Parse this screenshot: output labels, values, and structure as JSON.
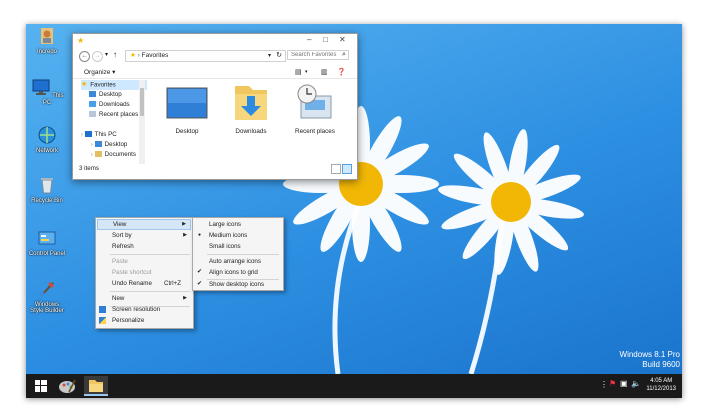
{
  "desktop": {
    "icons": [
      {
        "label": "Incredo",
        "icon": "user-icon"
      },
      {
        "label": "This PC",
        "icon": "computer-icon"
      },
      {
        "label": "Network",
        "icon": "network-icon"
      },
      {
        "label": "Recycle Bin",
        "icon": "recycle-bin-icon"
      },
      {
        "label": "Control Panel",
        "icon": "control-panel-icon"
      },
      {
        "label": "Windows Style Builder",
        "icon": "style-builder-icon"
      }
    ],
    "watermark": {
      "line1": "Windows 8.1 Pro",
      "line2": "Build 9600"
    }
  },
  "explorer": {
    "path_label": "Favorites",
    "search_placeholder": "Search Favorites",
    "controls": {
      "minimize": "–",
      "maximize": "□",
      "close": "✕"
    },
    "organize_label": "Organize ▾",
    "nav_items": [
      {
        "label": "Favorites",
        "selected": true,
        "icon": "star-icon"
      },
      {
        "label": "Desktop",
        "selected": false,
        "icon": "desktop-icon"
      },
      {
        "label": "Downloads",
        "selected": false,
        "icon": "downloads-icon"
      },
      {
        "label": "Recent places",
        "selected": false,
        "icon": "recent-places-icon"
      },
      {
        "label": "",
        "selected": false,
        "icon": ""
      },
      {
        "label": "This PC",
        "selected": false,
        "icon": "computer-icon"
      },
      {
        "label": "Desktop",
        "selected": false,
        "icon": "desktop-icon"
      },
      {
        "label": "Documents",
        "selected": false,
        "icon": "documents-icon"
      }
    ],
    "items": [
      {
        "label": "Desktop",
        "icon": "desktop-folder-icon"
      },
      {
        "label": "Downloads",
        "icon": "downloads-folder-icon"
      },
      {
        "label": "Recent places",
        "icon": "recent-places-folder-icon"
      }
    ],
    "status": "3 items"
  },
  "context_menu": {
    "items": [
      {
        "label": "View",
        "has_submenu": true,
        "highlighted": true,
        "disabled": false,
        "shortcut": ""
      },
      {
        "label": "Sort by",
        "has_submenu": true,
        "highlighted": false,
        "disabled": false,
        "shortcut": ""
      },
      {
        "label": "Refresh",
        "has_submenu": false,
        "highlighted": false,
        "disabled": false,
        "shortcut": ""
      },
      {
        "label": "Paste",
        "has_submenu": false,
        "highlighted": false,
        "disabled": true,
        "shortcut": ""
      },
      {
        "label": "Paste shortcut",
        "has_submenu": false,
        "highlighted": false,
        "disabled": true,
        "shortcut": ""
      },
      {
        "label": "Undo Rename",
        "has_submenu": false,
        "highlighted": false,
        "disabled": false,
        "shortcut": "Ctrl+Z"
      },
      {
        "label": "New",
        "has_submenu": true,
        "highlighted": false,
        "disabled": false,
        "shortcut": ""
      },
      {
        "label": "Screen resolution",
        "has_submenu": false,
        "highlighted": false,
        "disabled": false,
        "shortcut": "",
        "icon": "screen-resolution-icon"
      },
      {
        "label": "Personalize",
        "has_submenu": false,
        "highlighted": false,
        "disabled": false,
        "shortcut": "",
        "icon": "personalize-icon"
      }
    ]
  },
  "view_submenu": {
    "items": [
      {
        "label": "Large icons",
        "mark": ""
      },
      {
        "label": "Medium icons",
        "mark": "●"
      },
      {
        "label": "Small icons",
        "mark": ""
      },
      {
        "label": "Auto arrange icons",
        "mark": ""
      },
      {
        "label": "Align icons to grid",
        "mark": "✔"
      },
      {
        "label": "Show desktop icons",
        "mark": "✔"
      }
    ]
  },
  "taskbar": {
    "time": "4:05 AM",
    "date": "11/12/2013",
    "colors": {
      "background": "#1a1a1a"
    }
  }
}
